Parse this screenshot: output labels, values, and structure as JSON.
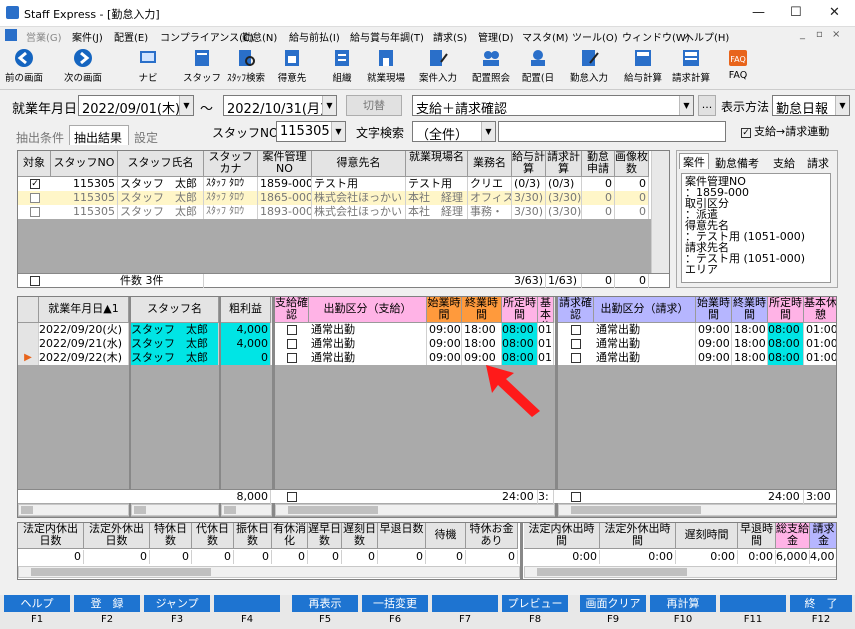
{
  "window": {
    "title": "Staff Express - [勤怠入力]",
    "min": "—",
    "max": "☐",
    "close": "✕"
  },
  "menu": [
    "営業(G)",
    "案件(J)",
    "配置(E)",
    "コンプライアンス(C)",
    "勤怠(N)",
    "給与前払(I)",
    "給与賞与年調(T)",
    "請求(S)",
    "管理(D)",
    "マスタ(M)",
    "ツール(O)",
    "ウィンドウ(W)",
    "ヘルプ(H)"
  ],
  "toolbar": [
    "前の画面",
    "次の画面",
    "ナビ",
    "スタッフ",
    "ｽﾀｯﾌ検索",
    "得意先",
    "組織",
    "就業現場",
    "案件入力",
    "配置照会",
    "配置(日",
    "勤怠入力",
    "給与計算",
    "請求計算",
    "FAQ"
  ],
  "filter": {
    "period_label": "就業年月日",
    "date_from": "2022/09/01(木)",
    "tilde": "～",
    "date_to": "2022/10/31(月)",
    "switch_label": "切替",
    "mode": "支給＋請求確認",
    "dots": "...",
    "display_label": "表示方法",
    "display_value": "勤怠日報",
    "staffno_label": "スタッフNO",
    "staffno_value": "115305",
    "search_label": "文字検索",
    "search_value": "（全件）",
    "link_check": "支給→請求連動"
  },
  "tabs": [
    "抽出条件",
    "抽出結果",
    "設定"
  ],
  "upper": {
    "headers": [
      "対象",
      "スタッフNO",
      "スタッフ氏名",
      "スタッフカナ",
      "案件管理NO",
      "得意先名",
      "就業現場名",
      "業務名",
      "給与計算",
      "請求計算",
      "勤怠申請",
      "画像枚数"
    ],
    "rows": [
      [
        "",
        "115305",
        "スタッフ　太郎",
        "ｽﾀｯﾌ ﾀﾛｳ",
        "1859-000",
        "テスト用",
        "テスト用",
        "クリエ",
        "(0/3)",
        "(0/3)",
        "0",
        "0"
      ],
      [
        "",
        "115305",
        "スタッフ　太郎",
        "ｽﾀｯﾌ ﾀﾛｳ",
        "1865-000",
        "株式会社ほっかい",
        "本社　経理",
        "オフィス",
        "3/30)",
        "(3/30)",
        "0",
        "0"
      ],
      [
        "",
        "115305",
        "スタッフ　太郎",
        "ｽﾀｯﾌ ﾀﾛｳ",
        "1893-000",
        "株式会社ほっかい",
        "本社　経理",
        "事務・",
        "3/30)",
        "(3/30)",
        "0",
        "0"
      ]
    ],
    "footer": {
      "count": "件数 3件",
      "kyu": "3/63)",
      "sei": "1/63)",
      "a": "0",
      "b": "0"
    }
  },
  "side": {
    "tabs": [
      "案件",
      "勤怠備考",
      "支給",
      "請求"
    ],
    "lines": [
      "案件管理NO",
      "：1859-000",
      "取引区分",
      "：派遣",
      "得意先名",
      "：テスト用 (1051-000)",
      "請求先名",
      "：テスト用 (1051-000)",
      "エリア"
    ]
  },
  "lower": {
    "left_headers": [
      "就業年月日▲1",
      "スタッフ名",
      "粗利益"
    ],
    "mid_headers": [
      "支給確認",
      "出勤区分（支給）",
      "始業時間",
      "終業時間",
      "所定時間",
      "基本休"
    ],
    "right_headers": [
      "請求確認",
      "出勤区分（請求）",
      "始業時間",
      "終業時間",
      "所定時間",
      "基本休憩"
    ],
    "rows": [
      {
        "date": "2022/09/20(火)",
        "name": "スタッフ　太郎",
        "profit": "4,000",
        "kbn": "通常出勤",
        "start": "09:00",
        "end": "18:00",
        "std": "08:00",
        "rest": "01:",
        "kbn2": "通常出勤",
        "start2": "09:00",
        "end2": "18:00",
        "std2": "08:00",
        "rest2": "01:00"
      },
      {
        "date": "2022/09/21(水)",
        "name": "スタッフ　太郎",
        "profit": "4,000",
        "kbn": "通常出勤",
        "start": "09:00",
        "end": "18:00",
        "std": "08:00",
        "rest": "01:",
        "kbn2": "通常出勤",
        "start2": "09:00",
        "end2": "18:00",
        "std2": "08:00",
        "rest2": "01:00"
      },
      {
        "date": "2022/09/22(木)",
        "name": "スタッフ　太郎",
        "profit": "0",
        "kbn": "通常出勤",
        "start": "09:00",
        "end": "09:00",
        "std": "08:00",
        "rest": "01:",
        "kbn2": "通常出勤",
        "start2": "09:00",
        "end2": "18:00",
        "std2": "08:00",
        "rest2": "01:00"
      }
    ],
    "totals": {
      "profit": "8,000",
      "std": "24:00",
      "rest": "3:",
      "std2": "24:00",
      "rest2": "3:00"
    }
  },
  "summary": {
    "left_headers": [
      "法定内休出日数",
      "法定外休出日数",
      "特休日数",
      "代休日数",
      "振休日数",
      "有休消化",
      "遅早日数",
      "遅刻日数",
      "早退日数",
      "待機",
      "特休お金あり"
    ],
    "left_values": [
      "0",
      "0",
      "0",
      "0",
      "0",
      "0",
      "0",
      "0",
      "0",
      "0",
      "0"
    ],
    "right_headers": [
      "法定内休出時間",
      "法定外休出時間",
      "遅刻時間",
      "早退時間",
      "総支給金",
      "請求金"
    ],
    "right_values": [
      "0:00",
      "0:00",
      "0:00",
      "0:00",
      "6,000",
      "4,00"
    ]
  },
  "fkeys": [
    {
      "label": "ヘルプ",
      "key": "F1"
    },
    {
      "label": "登　録",
      "key": "F2"
    },
    {
      "label": "ジャンプ",
      "key": "F3"
    },
    {
      "label": "",
      "key": "F4"
    },
    {
      "label": "再表示",
      "key": "F5"
    },
    {
      "label": "一括変更",
      "key": "F6"
    },
    {
      "label": "",
      "key": "F7"
    },
    {
      "label": "プレビュー",
      "key": "F8"
    },
    {
      "label": "画面クリア",
      "key": "F9"
    },
    {
      "label": "再計算",
      "key": "F10"
    },
    {
      "label": "",
      "key": "F11"
    },
    {
      "label": "終　了",
      "key": "F12"
    }
  ]
}
